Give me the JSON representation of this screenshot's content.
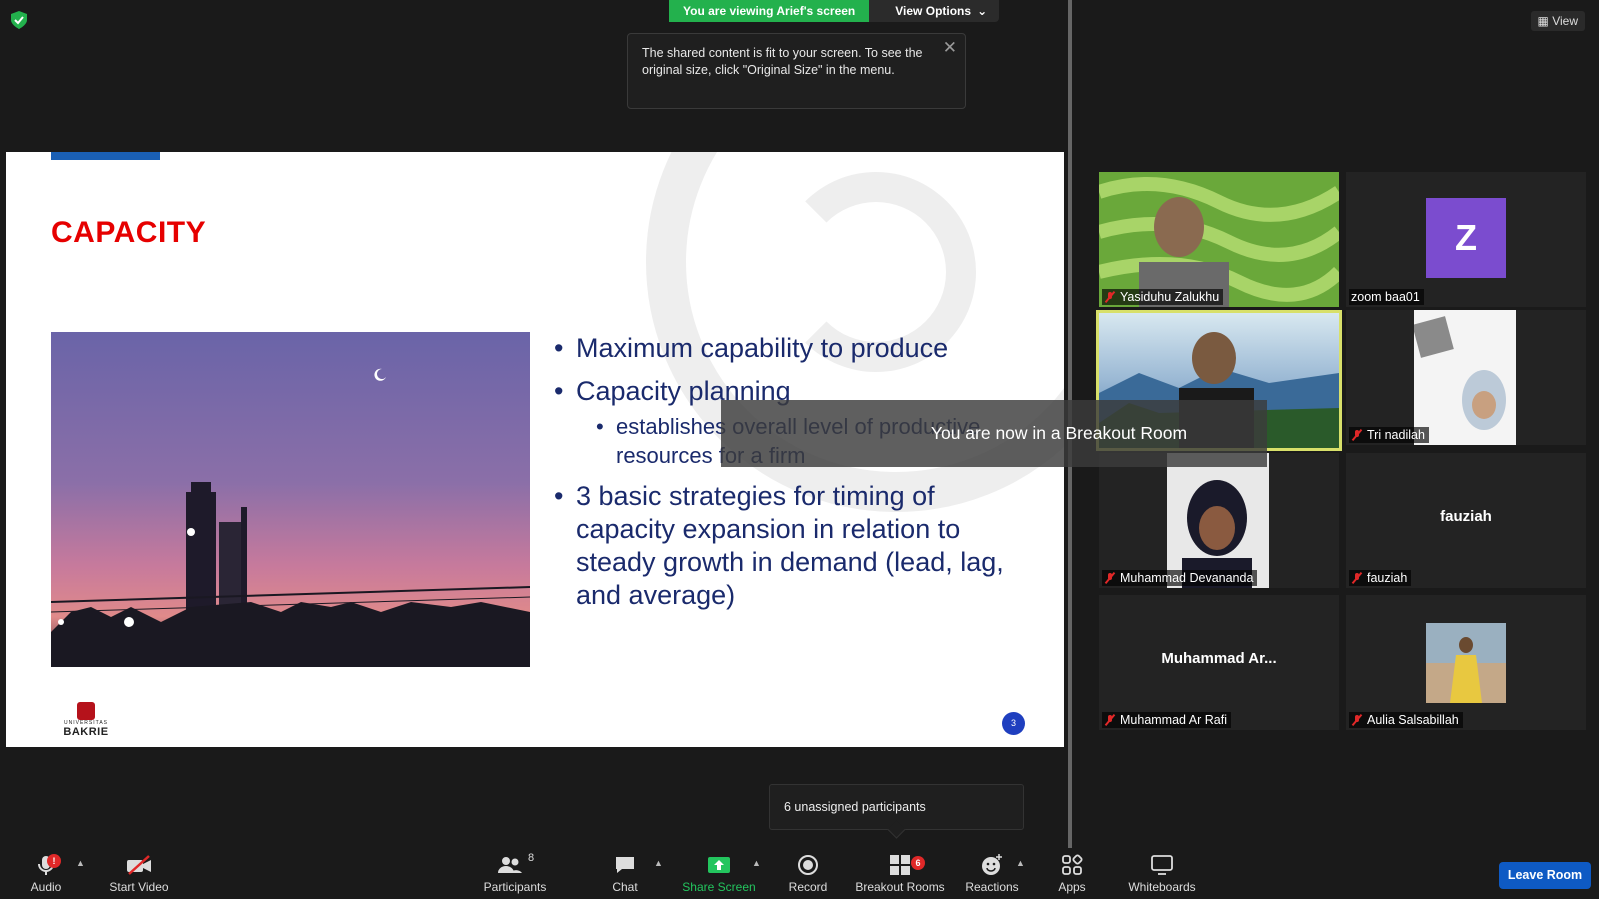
{
  "share": {
    "banner_text": "You are viewing Arief's screen",
    "view_options_label": "View Options",
    "tooltip_text": "The shared content is fit to your screen. To see the original size, click \"Original Size\" in the menu."
  },
  "view_button_label": "View",
  "slide": {
    "title": "CAPACITY",
    "bullets": [
      "Maximum capability to produce",
      "Capacity planning",
      "3 basic strategies for timing of capacity expansion in relation to steady growth in demand (lead, lag, and average)"
    ],
    "sub_bullet": "establishes overall level of productive resources for a firm",
    "logo_small": "UNIVERSITAS",
    "logo_big": "BAKRIE",
    "page_number": "3"
  },
  "breakout_message": "You are now in a Breakout Room",
  "participants": [
    {
      "name": "Yasiduhu Zalukhu",
      "muted": true
    },
    {
      "name": "zoom baa01",
      "muted": false,
      "initial": "Z"
    },
    {
      "name": "",
      "muted": true
    },
    {
      "name": "Tri nadilah",
      "muted": true
    },
    {
      "name": "Muhammad Devananda",
      "muted": true
    },
    {
      "name": "fauziah",
      "muted": true,
      "center": "fauziah"
    },
    {
      "name": "Muhammad Ar Rafi",
      "muted": true,
      "center": "Muhammad  Ar..."
    },
    {
      "name": "Aulia Salsabillah",
      "muted": true
    }
  ],
  "toolbar": {
    "audio": "Audio",
    "audio_badge": "!",
    "start_video": "Start Video",
    "participants": "Participants",
    "participants_count": "8",
    "chat": "Chat",
    "share_screen": "Share Screen",
    "record": "Record",
    "breakout_rooms": "Breakout Rooms",
    "breakout_badge": "6",
    "reactions": "Reactions",
    "apps": "Apps",
    "whiteboards": "Whiteboards",
    "leave_room": "Leave Room"
  },
  "unassigned_popup": "6 unassigned participants",
  "colors": {
    "green_share": "#23b14d",
    "slide_title": "#e60000",
    "bullet_text": "#1a2a6c",
    "leave_blue": "#0e5ac4",
    "active_speaker": "#d8e06a"
  }
}
